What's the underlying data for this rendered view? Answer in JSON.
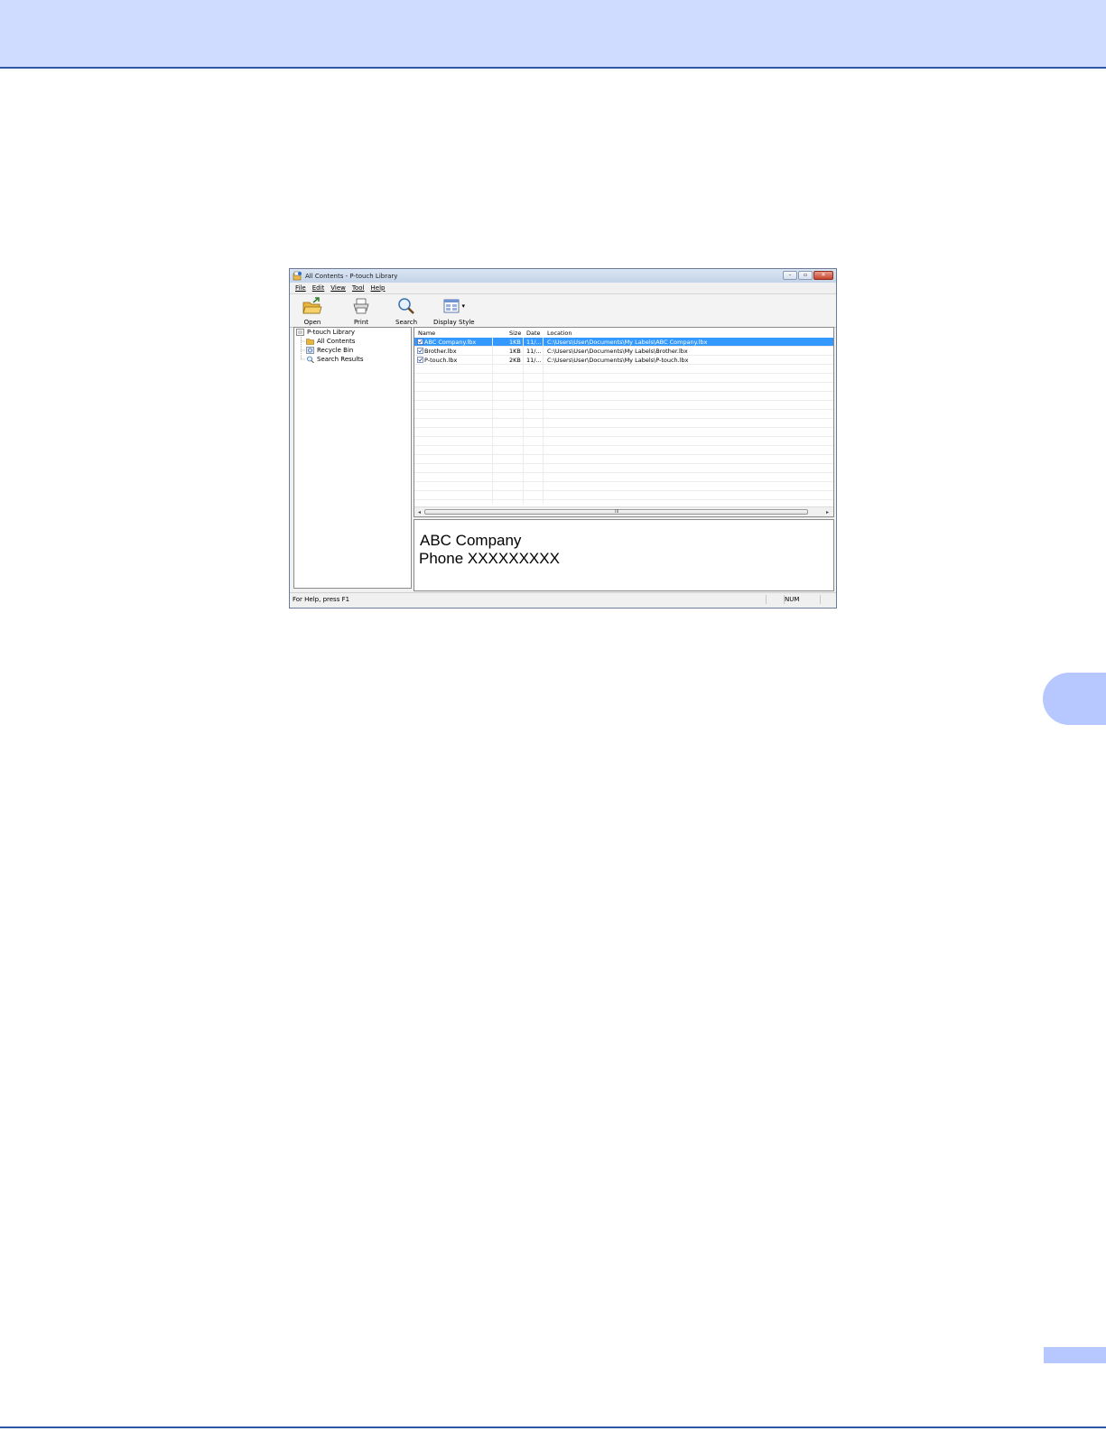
{
  "window": {
    "title": "All Contents - P-touch Library",
    "controls": {
      "minimize": "–",
      "maximize": "▫",
      "close": "✕"
    }
  },
  "menu": [
    "File",
    "Edit",
    "View",
    "Tool",
    "Help"
  ],
  "toolbar": {
    "open_label": "Open",
    "print_label": "Print",
    "search_label": "Search",
    "display_style_label": "Display Style",
    "dropdown_glyph": "▾"
  },
  "tree": {
    "root": "P-touch Library",
    "items": [
      "All Contents",
      "Recycle Bin",
      "Search Results"
    ]
  },
  "list": {
    "columns": [
      "Name",
      "Size",
      "Date",
      "Location"
    ],
    "rows": [
      {
        "name": "ABC Company.lbx",
        "size": "1KB",
        "date": "11/...",
        "location": "C:\\Users\\User\\Documents\\My Labels\\ABC Company.lbx",
        "selected": true
      },
      {
        "name": "Brother.lbx",
        "size": "1KB",
        "date": "11/...",
        "location": "C:\\Users\\User\\Documents\\My Labels\\Brother.lbx",
        "selected": false
      },
      {
        "name": "P-touch.lbx",
        "size": "2KB",
        "date": "11/...",
        "location": "C:\\Users\\User\\Documents\\My Labels\\P-touch.lbx",
        "selected": false
      }
    ],
    "scroll_left": "◂",
    "scroll_right": "▸",
    "scroll_grip": "III"
  },
  "preview": {
    "line1": "ABC Company",
    "line2": "Phone XXXXXXXXX"
  },
  "status": {
    "help_text": "For Help, press F1",
    "num": "NUM"
  },
  "colors": {
    "header_band": "#cfdcff",
    "accent_line": "#2f57a8",
    "selection": "#3399ff"
  }
}
